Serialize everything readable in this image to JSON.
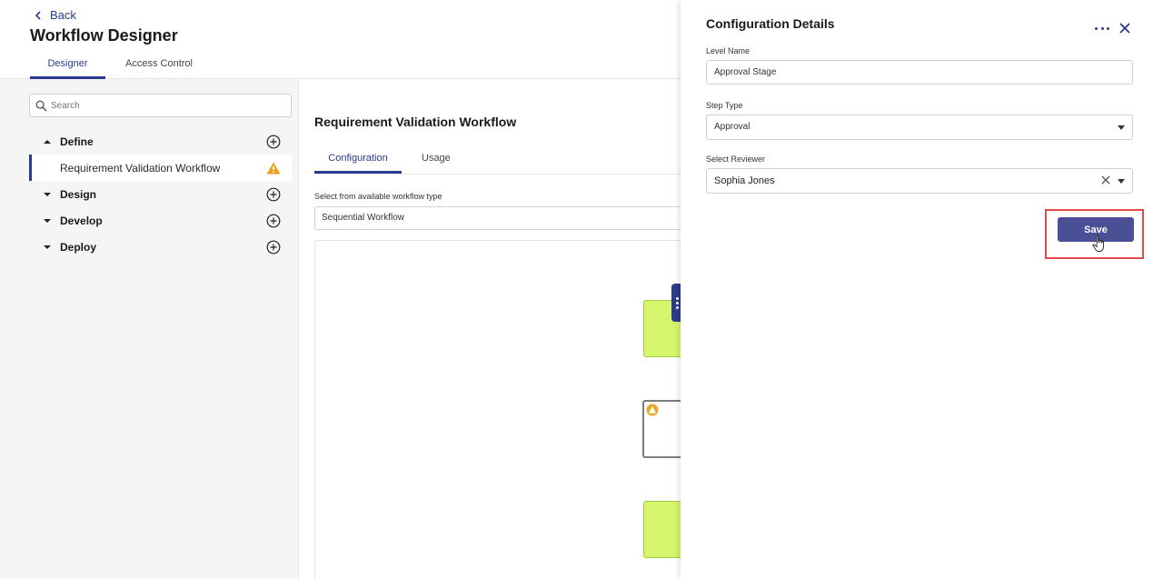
{
  "header": {
    "back_label": "Back",
    "title": "Workflow Designer",
    "tabs": [
      {
        "label": "Designer",
        "active": true
      },
      {
        "label": "Access Control",
        "active": false
      }
    ]
  },
  "sidebar": {
    "search_placeholder": "Search",
    "tree": [
      {
        "label": "Define",
        "expanded": true,
        "children": [
          {
            "label": "Requirement Validation Workflow",
            "warning": true
          }
        ]
      },
      {
        "label": "Design",
        "expanded": false
      },
      {
        "label": "Develop",
        "expanded": false
      },
      {
        "label": "Deploy",
        "expanded": false
      }
    ]
  },
  "main": {
    "title": "Requirement Validation Workflow",
    "tabs": [
      {
        "label": "Configuration",
        "active": true
      },
      {
        "label": "Usage",
        "active": false
      }
    ],
    "workflow_type_label": "Select from available workflow type",
    "workflow_type_value": "Sequential Workflow"
  },
  "drawer": {
    "title": "Configuration Details",
    "level_name_label": "Level Name",
    "level_name_value": "Approval Stage",
    "step_type_label": "Step Type",
    "step_type_value": "Approval",
    "reviewer_label": "Select Reviewer",
    "reviewer_value": "Sophia Jones",
    "save_label": "Save"
  },
  "colors": {
    "accent": "#2b3a8c",
    "save_button": "#4a4f96",
    "node_green": "#d5f56c",
    "warning": "#f0a020",
    "highlight": "#e24a4a"
  }
}
